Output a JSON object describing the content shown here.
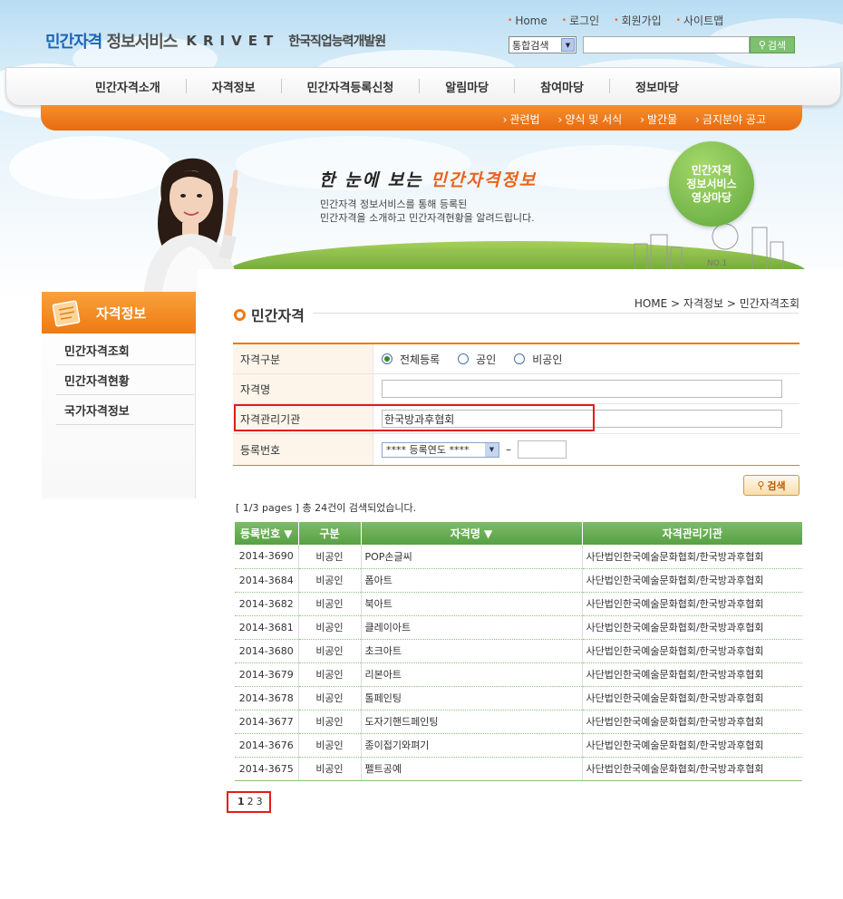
{
  "header": {
    "logo_main_a": "민간자격",
    "logo_main_b": "정보서비스",
    "logo_krivet": "KRIVET",
    "logo_org": "한국직업능력개발원",
    "util_links": [
      "Home",
      "로그인",
      "회원가입",
      "사이트맵"
    ],
    "search_scope": "통합검색",
    "search_value": "",
    "search_button": "검색"
  },
  "nav": {
    "items": [
      "민간자격소개",
      "자격정보",
      "민간자격등록신청",
      "알림마당",
      "참여마당",
      "정보마당"
    ]
  },
  "subnav": {
    "items": [
      "관련법",
      "양식 및 서식",
      "발간물",
      "금지분야 공고"
    ]
  },
  "banner": {
    "title_a": "한 눈에 보는",
    "title_b": "민간자격정보",
    "desc_1": "민간자격 정보서비스를 통해 등록된",
    "desc_2": "민간자격을 소개하고 민간자격현황을 알려드립니다.",
    "circle_1": "민간자격",
    "circle_2": "정보서비스",
    "circle_3": "영상마당"
  },
  "sidebar": {
    "title": "자격정보",
    "items": [
      "민간자격조회",
      "민간자격현황",
      "국가자격정보"
    ]
  },
  "page": {
    "title": "민간자격",
    "breadcrumb": "HOME > 자격정보 > 민간자격조회"
  },
  "form": {
    "label_type": "자격구분",
    "radios": [
      {
        "label": "전체등록",
        "selected": true
      },
      {
        "label": "공인",
        "selected": false
      },
      {
        "label": "비공인",
        "selected": false
      }
    ],
    "label_name": "자격명",
    "name_value": "",
    "label_org": "자격관리기관",
    "org_value": "한국방과후협회",
    "label_regno": "등록번호",
    "year_select": "**** 등록연도 ****",
    "dash": "–",
    "regno_value": "",
    "search_button": "검색"
  },
  "results": {
    "info": "[ 1/3 pages ] 총 24건이 검색되었습니다.",
    "columns": [
      "등록번호 ▼",
      "구분",
      "자격명 ▼",
      "자격관리기관"
    ],
    "rows": [
      [
        "2014-3690",
        "비공인",
        "POP손글씨",
        "사단법인한국예술문화협회/한국방과후협회"
      ],
      [
        "2014-3684",
        "비공인",
        "폼아트",
        "사단법인한국예술문화협회/한국방과후협회"
      ],
      [
        "2014-3682",
        "비공인",
        "북아트",
        "사단법인한국예술문화협회/한국방과후협회"
      ],
      [
        "2014-3681",
        "비공인",
        "클레이아트",
        "사단법인한국예술문화협회/한국방과후협회"
      ],
      [
        "2014-3680",
        "비공인",
        "초크아트",
        "사단법인한국예술문화협회/한국방과후협회"
      ],
      [
        "2014-3679",
        "비공인",
        "리본아트",
        "사단법인한국예술문화협회/한국방과후협회"
      ],
      [
        "2014-3678",
        "비공인",
        "톨페인팅",
        "사단법인한국예술문화협회/한국방과후협회"
      ],
      [
        "2014-3677",
        "비공인",
        "도자기핸드페인팅",
        "사단법인한국예술문화협회/한국방과후협회"
      ],
      [
        "2014-3676",
        "비공인",
        "종이접기와펴기",
        "사단법인한국예술문화협회/한국방과후협회"
      ],
      [
        "2014-3675",
        "비공인",
        "펠트공예",
        "사단법인한국예술문화협회/한국방과후협회"
      ]
    ]
  },
  "pagination": {
    "pages": [
      "1",
      "2",
      "3"
    ],
    "current": "1"
  },
  "colors": {
    "orange": "#ef7a12",
    "green_header": "#57a044",
    "highlight_red": "#e31b1b",
    "brand_blue": "#1b65b8"
  }
}
